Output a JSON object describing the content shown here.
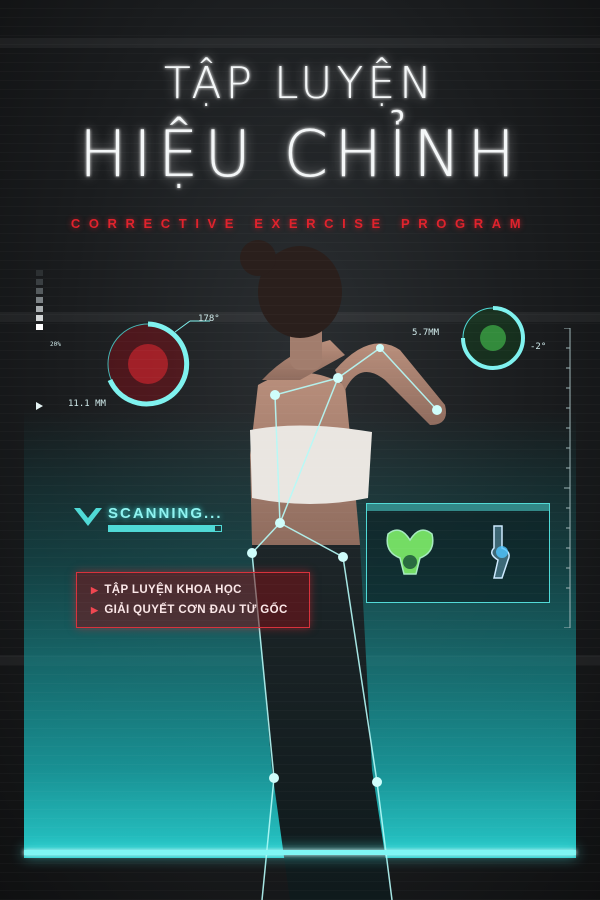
{
  "title_line1": "TẬP LUYỆN",
  "title_line2": "HIỆU CHỈNH",
  "subtitle": "CORRECTIVE EXERCISE PROGRAM",
  "hud": {
    "gauge_left_angle": "178°",
    "gauge_left_measure": "11.1 MM",
    "gauge_right_measure": "5.7MM",
    "gauge_right_angle": "-2°",
    "level_percent": "20%",
    "scan_label": "SCANNING...",
    "scan_progress_fraction": 0.95
  },
  "features": [
    "TẬP LUYỆN KHOA HỌC",
    "GIẢI QUYẾT CƠN ĐAU TỪ GỐC"
  ],
  "colors": {
    "accent_teal": "#4fd9d6",
    "accent_red": "#e0222c",
    "title_white": "#f4f7f8"
  }
}
